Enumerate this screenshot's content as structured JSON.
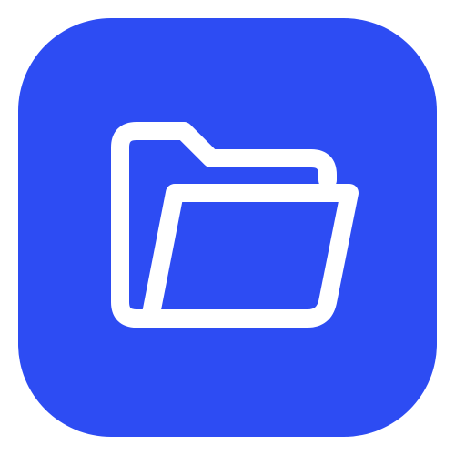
{
  "app_icon": {
    "icon": "open-folder-icon",
    "colors": {
      "tile": "#2d4cf3",
      "glyph": "#ffffff",
      "background": "#ffffff"
    }
  }
}
